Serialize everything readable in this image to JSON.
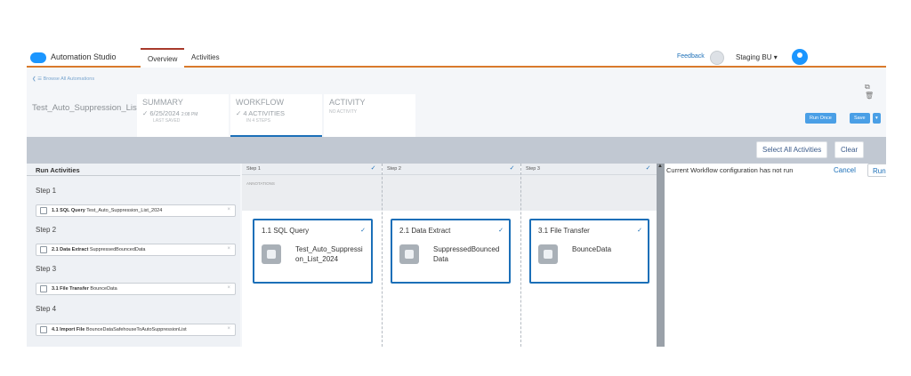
{
  "nav": {
    "app_name": "Automation Studio",
    "tabs": [
      {
        "label": "Overview"
      },
      {
        "label": "Activities"
      }
    ],
    "feedback": "Feedback",
    "business_unit": "Staging BU ▾"
  },
  "header": {
    "browse_link": "❮ ☰ Browse All Automations",
    "automation_name": "Test_Auto_Suppression_List",
    "stages": {
      "summary": {
        "title": "SUMMARY",
        "date": "6/25/2024",
        "time": "2:08 PM",
        "sub": "LAST SAVED"
      },
      "workflow": {
        "title": "WORKFLOW",
        "value": "4 ACTIVITIES",
        "sub": "IN 4 STEPS"
      },
      "activity": {
        "title": "ACTIVITY",
        "value": "NO ACTIVITY"
      }
    },
    "run_once": "Run Once",
    "save": "Save",
    "save_menu": "▾",
    "icons": "⧉ 🗑"
  },
  "toolbar": {
    "select_all": "Select All Activities",
    "clear": "Clear"
  },
  "run_panel": {
    "title": "Run Activities",
    "steps": [
      {
        "label": "Step 1",
        "activity_num": "1.1 SQL Query",
        "activity_name": "Test_Auto_Suppression_List_2024"
      },
      {
        "label": "Step 2",
        "activity_num": "2.1 Data Extract",
        "activity_name": "SuppressedBouncedData"
      },
      {
        "label": "Step 3",
        "activity_num": "3.1 File Transfer",
        "activity_name": "BounceData"
      },
      {
        "label": "Step 4",
        "activity_num": "4.1 Import File",
        "activity_name": "BounceDataSafehouseToAutoSuppressionList"
      }
    ],
    "remove_glyph": "×"
  },
  "canvas": {
    "columns": [
      {
        "label": "Step 1"
      },
      {
        "label": "Step 2"
      },
      {
        "label": "Step 3"
      }
    ],
    "annotations": "ANNOTATIONS",
    "cards": [
      {
        "title": "1.1 SQL Query",
        "text": "Test_Auto_Suppression_List_2024"
      },
      {
        "title": "2.1 Data Extract",
        "text": "SuppressedBouncedData"
      },
      {
        "title": "3.1 File Transfer",
        "text": "BounceData"
      }
    ],
    "check": "✓"
  },
  "status": {
    "message": "Current Workflow configuration has not run",
    "cancel": "Cancel",
    "run": "Run",
    "scroll_arrow": "▲"
  },
  "colors": {
    "accent_orange": "#d97a2b",
    "brand_blue": "#1b6fb8",
    "band_gray": "#c1c8d2"
  }
}
